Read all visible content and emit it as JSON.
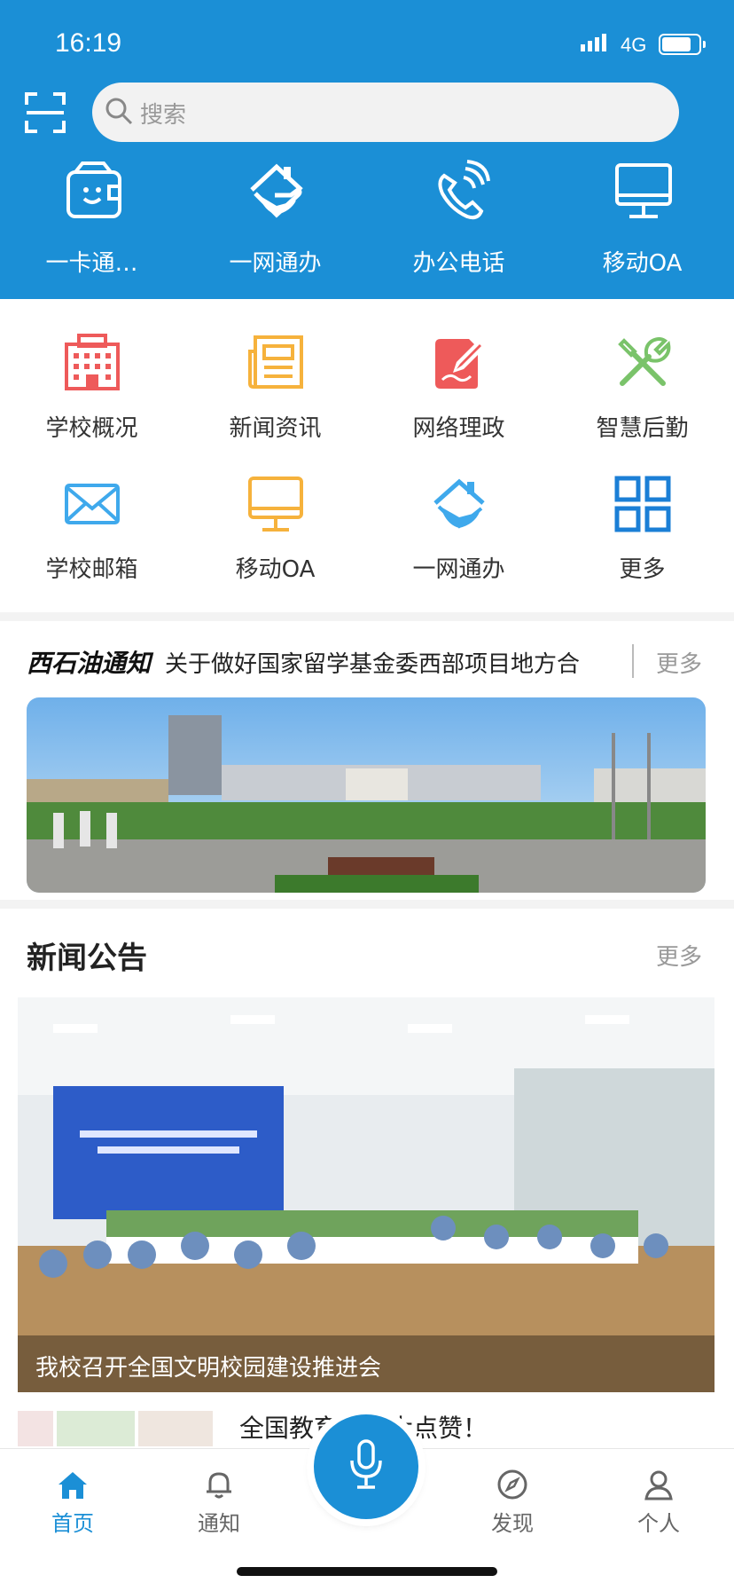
{
  "status_bar": {
    "time": "16:19",
    "network": "4G"
  },
  "search": {
    "placeholder": "搜索"
  },
  "quick_actions": [
    {
      "label": "一卡通…",
      "icon": "wallet-card-icon"
    },
    {
      "label": "一网通办",
      "icon": "house-hand-icon"
    },
    {
      "label": "办公电话",
      "icon": "phone-icon"
    },
    {
      "label": "移动OA",
      "icon": "monitor-icon"
    }
  ],
  "services": [
    {
      "label": "学校概况",
      "icon": "building-icon"
    },
    {
      "label": "新闻资讯",
      "icon": "newspaper-icon"
    },
    {
      "label": "网络理政",
      "icon": "pen-edit-icon"
    },
    {
      "label": "智慧后勤",
      "icon": "tools-icon"
    },
    {
      "label": "学校邮箱",
      "icon": "mail-icon"
    },
    {
      "label": "移动OA",
      "icon": "monitor-icon"
    },
    {
      "label": "一网通办",
      "icon": "house-hand-icon"
    },
    {
      "label": "更多",
      "icon": "grid-more-icon"
    }
  ],
  "notice": {
    "brand": "西石油通知",
    "title": "关于做好国家留学基金委西部项目地方合",
    "more": "更多"
  },
  "news_section": {
    "title": "新闻公告",
    "more": "更多",
    "featured_caption": "我校召开全国文明校园建设推进会",
    "second_headline": "全国教育…石大点赞！"
  },
  "tabbar": [
    {
      "label": "首页",
      "icon": "home-icon",
      "active": true
    },
    {
      "label": "通知",
      "icon": "bell-icon",
      "active": false
    },
    {
      "label": "发现",
      "icon": "compass-icon",
      "active": false
    },
    {
      "label": "个人",
      "icon": "person-icon",
      "active": false
    }
  ],
  "colors": {
    "primary": "#1b8fd6",
    "red": "#ee5a5a",
    "orange": "#f6b23c",
    "green": "#7ac36a",
    "lightblue": "#3fa9ec"
  }
}
